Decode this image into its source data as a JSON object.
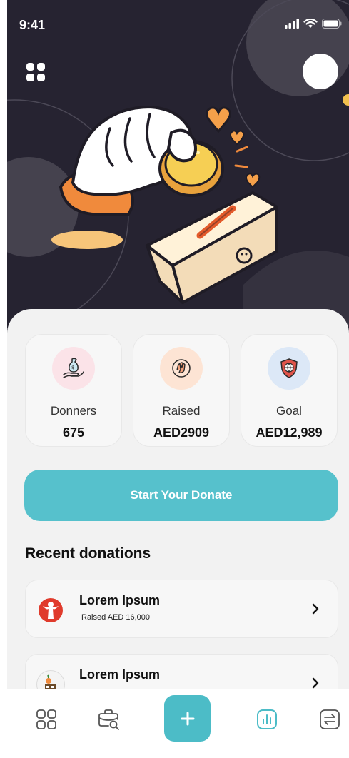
{
  "status_bar": {
    "time": "9:41"
  },
  "stats": [
    {
      "label": "Donners",
      "value": "675"
    },
    {
      "label": "Raised",
      "value": "AED2909"
    },
    {
      "label": "Goal",
      "value": "AED12,989"
    }
  ],
  "donate_button": {
    "label": "Start Your Donate"
  },
  "recent": {
    "title": "Recent donations",
    "items": [
      {
        "title": "Lorem Ipsum",
        "subtitle": "Raised AED 16,000"
      },
      {
        "title": "Lorem Ipsum",
        "subtitle": ""
      }
    ]
  },
  "colors": {
    "hero_background": "#262331",
    "accent": "#56c1cc",
    "coin": "#f2c14e",
    "heart": "#f5a04a"
  },
  "icons": {
    "tab_bar": [
      "grid-icon",
      "briefcase-search-icon",
      "plus-icon",
      "chart-icon",
      "transfer-icon"
    ]
  }
}
